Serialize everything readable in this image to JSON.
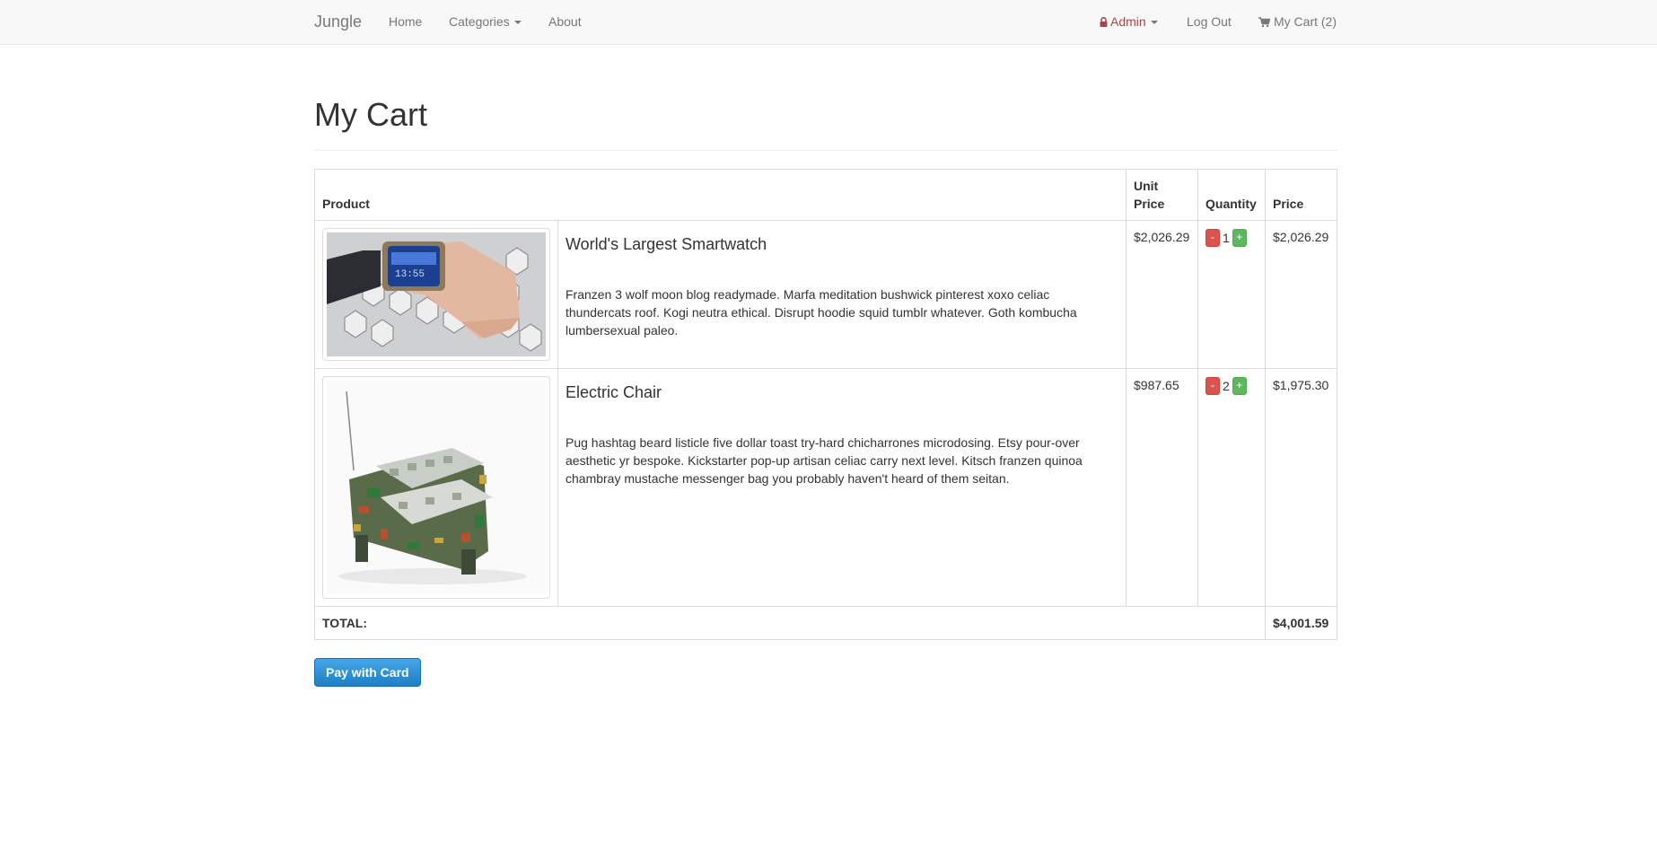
{
  "navbar": {
    "brand": "Jungle",
    "home": "Home",
    "categories": "Categories",
    "about": "About",
    "admin": "Admin",
    "logout": "Log Out",
    "cart": "My Cart (2)",
    "admin_color": "#a94442"
  },
  "page": {
    "title": "My Cart"
  },
  "table": {
    "headers": {
      "product": "Product",
      "unit_price": "Unit Price",
      "quantity": "Quantity",
      "price": "Price"
    },
    "items": [
      {
        "name": "World's Largest Smartwatch",
        "description": "Franzen 3 wolf moon blog readymade. Marfa meditation bushwick pinterest xoxo celiac thundercats roof. Kogi neutra ethical. Disrupt hoodie squid tumblr whatever. Goth kombucha lumbersexual paleo.",
        "unit_price": "$2,026.29",
        "quantity": "1",
        "price": "$2,026.29",
        "image": "smartwatch-image"
      },
      {
        "name": "Electric Chair",
        "description": "Pug hashtag beard listicle five dollar toast try-hard chicharrones microdosing. Etsy pour-over aesthetic yr bespoke. Kickstarter pop-up artisan celiac carry next level. Kitsch franzen quinoa chambray mustache messenger bag you probably haven't heard of them seitan.",
        "unit_price": "$987.65",
        "quantity": "2",
        "price": "$1,975.30",
        "image": "electric-chair-image"
      }
    ],
    "total_label": "TOTAL:",
    "total_value": "$4,001.59",
    "minus_label": "-",
    "plus_label": "+"
  },
  "pay_button": "Pay with Card"
}
